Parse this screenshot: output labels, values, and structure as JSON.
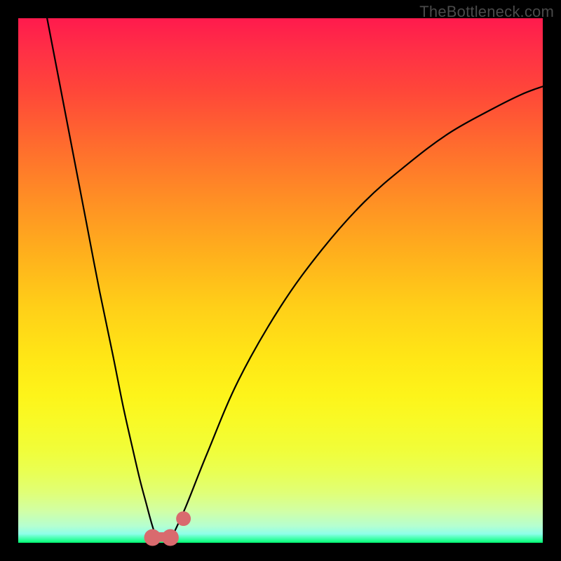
{
  "watermark": "TheBottleneck.com",
  "colors": {
    "page_bg": "#000000",
    "watermark_text": "#4a4a4a",
    "curve_stroke": "#000000",
    "marker_fill": "#d96a6e",
    "gradient_top": "#ff1a4d",
    "gradient_bottom": "#00ff72"
  },
  "chart_data": {
    "type": "line",
    "title": "",
    "xlabel": "",
    "ylabel": "",
    "x_range": [
      0,
      1
    ],
    "y_range": [
      0,
      1
    ],
    "series": [
      {
        "name": "left-branch",
        "x": [
          0.055,
          0.08,
          0.105,
          0.13,
          0.155,
          0.18,
          0.2,
          0.218,
          0.232,
          0.244,
          0.252,
          0.258,
          0.262
        ],
        "y": [
          1.0,
          0.87,
          0.74,
          0.61,
          0.48,
          0.36,
          0.26,
          0.18,
          0.12,
          0.075,
          0.045,
          0.025,
          0.015
        ]
      },
      {
        "name": "right-branch",
        "x": [
          0.295,
          0.32,
          0.36,
          0.42,
          0.5,
          0.58,
          0.66,
          0.74,
          0.82,
          0.9,
          0.96,
          1.0
        ],
        "y": [
          0.015,
          0.07,
          0.17,
          0.31,
          0.45,
          0.56,
          0.65,
          0.72,
          0.78,
          0.825,
          0.855,
          0.87
        ]
      }
    ],
    "markers": [
      {
        "name": "trough-left-end",
        "x": 0.256,
        "y": 0.01,
        "r": 0.016
      },
      {
        "name": "trough-right-end",
        "x": 0.29,
        "y": 0.01,
        "r": 0.016
      },
      {
        "name": "dot-right",
        "x": 0.315,
        "y": 0.046,
        "r": 0.014
      }
    ],
    "marker_bar": {
      "x0": 0.256,
      "x1": 0.29,
      "y": 0.002,
      "thickness": 0.018
    }
  }
}
